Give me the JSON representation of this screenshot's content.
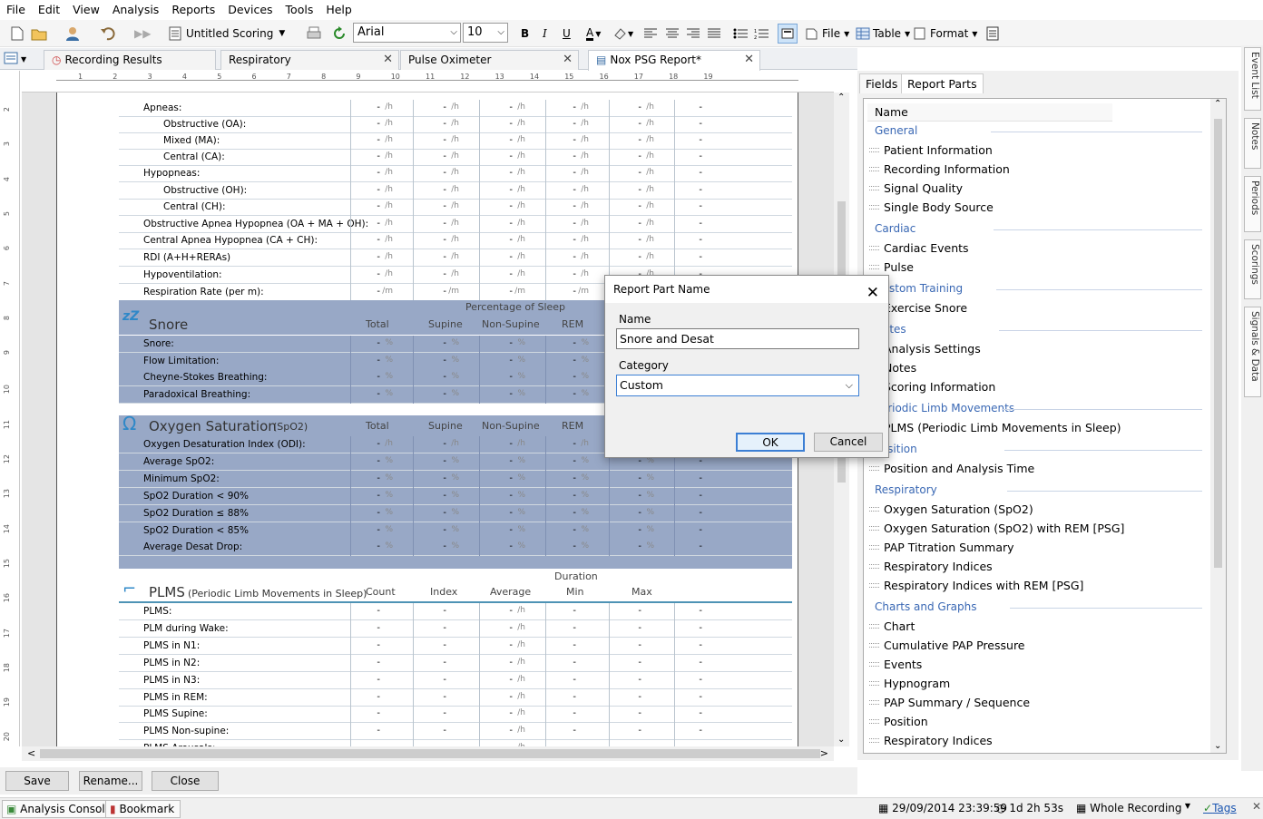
{
  "menu": [
    "File",
    "Edit",
    "View",
    "Analysis",
    "Reports",
    "Devices",
    "Tools",
    "Help"
  ],
  "toolbar": {
    "scoring": "Untitled Scoring",
    "font": "Arial",
    "size": "10",
    "file": "File",
    "table": "Table",
    "format": "Format"
  },
  "doc_tabs": [
    "Recording Results",
    "Respiratory",
    "Pulse Oximeter",
    "Nox PSG Report*"
  ],
  "ruler_marks": [
    "1",
    "2",
    "3",
    "4",
    "5",
    "6",
    "7",
    "8",
    "9",
    "10",
    "11",
    "12",
    "13",
    "14",
    "15",
    "16",
    "17",
    "18",
    "19"
  ],
  "vruler_marks": [
    "2",
    "3",
    "4",
    "5",
    "6",
    "7",
    "8",
    "9",
    "10",
    "11",
    "12",
    "13",
    "14",
    "15",
    "16",
    "17",
    "18",
    "19",
    "20"
  ],
  "resp_rows": [
    {
      "label": "Apneas:",
      "unit": "/h",
      "indent": 0
    },
    {
      "label": "Obstructive (OA):",
      "unit": "/h",
      "indent": 1
    },
    {
      "label": "Mixed (MA):",
      "unit": "/h",
      "indent": 1
    },
    {
      "label": "Central (CA):",
      "unit": "/h",
      "indent": 1
    },
    {
      "label": "Hypopneas:",
      "unit": "/h",
      "indent": 0
    },
    {
      "label": "Obstructive (OH):",
      "unit": "/h",
      "indent": 1
    },
    {
      "label": "Central (CH):",
      "unit": "/h",
      "indent": 1
    },
    {
      "label": "Obstructive Apnea Hypopnea (OA + MA + OH):",
      "unit": "/h",
      "indent": 0
    },
    {
      "label": "Central Apnea Hypopnea (CA + CH):",
      "unit": "/h",
      "indent": 0
    },
    {
      "label": "RDI (A+H+RERAs)",
      "unit": "/h",
      "indent": 0
    },
    {
      "label": "Hypoventilation:",
      "unit": "/h",
      "indent": 0
    },
    {
      "label": "Respiration Rate (per m):",
      "unit": "/m",
      "indent": 0
    }
  ],
  "snore": {
    "title": "Snore",
    "pct_header": "Percentage of Sleep",
    "cols": [
      "Total",
      "Supine",
      "Non-Supine",
      "REM"
    ],
    "rows": [
      "Snore:",
      "Flow Limitation:",
      "Cheyne-Stokes Breathing:",
      "Paradoxical Breathing:"
    ]
  },
  "oxy": {
    "title": "Oxygen Saturation",
    "suffix": "(SpO2)",
    "cols": [
      "Total",
      "Supine",
      "Non-Supine",
      "REM"
    ],
    "rows": [
      {
        "label": "Oxygen Desaturation Index (ODI):",
        "unit": "/h",
        "min": false
      },
      {
        "label": "Average SpO2:",
        "unit": "%",
        "min": false
      },
      {
        "label": "Minimum SpO2:",
        "unit": "%",
        "min": false
      },
      {
        "label": "SpO2 Duration < 90%",
        "unit": "%",
        "min": true
      },
      {
        "label": "SpO2 Duration ≤ 88%",
        "unit": "%",
        "min": true
      },
      {
        "label": "SpO2 Duration < 85%",
        "unit": "%",
        "min": true
      },
      {
        "label": "Average Desat Drop:",
        "unit": "%",
        "min": false
      }
    ]
  },
  "plms": {
    "title": "PLMS",
    "suffix": "(Periodic Limb Movements in Sleep)",
    "duration": "Duration",
    "cols": [
      "Count",
      "Index",
      "Average",
      "Min",
      "Max"
    ],
    "rows": [
      "PLMS:",
      "PLM during Wake:",
      "PLMS in N1:",
      "PLMS in N2:",
      "PLMS in N3:",
      "PLMS in REM:",
      "PLMS Supine:",
      "PLMS Non-supine:",
      "PLMS Arousals:"
    ]
  },
  "right_tabs": [
    "Fields",
    "Report Parts"
  ],
  "list_header": "Name",
  "parts": [
    {
      "cat": "General",
      "items": [
        "Patient Information",
        "Recording Information",
        "Signal Quality",
        "Single Body Source"
      ]
    },
    {
      "cat": "Cardiac",
      "items": [
        "Cardiac Events",
        "Pulse"
      ]
    },
    {
      "cat": "Custom Training",
      "items": [
        "Exercise Snore"
      ]
    },
    {
      "cat": "Notes",
      "items": [
        "Analysis Settings",
        "Notes",
        "Scoring Information"
      ]
    },
    {
      "cat": "Periodic Limb Movements",
      "items": [
        "PLMS (Periodic Limb Movements in Sleep)"
      ]
    },
    {
      "cat": "Position",
      "items": [
        "Position and Analysis Time"
      ]
    },
    {
      "cat": "Respiratory",
      "items": [
        "Oxygen Saturation (SpO2)",
        "Oxygen Saturation (SpO2) with REM [PSG]",
        "PAP Titration Summary",
        "Respiratory Indices",
        "Respiratory Indices with REM [PSG]"
      ]
    },
    {
      "cat": "Charts and Graphs",
      "items": [
        "Chart",
        "Cumulative PAP Pressure",
        "Events",
        "Hypnogram",
        "PAP Summary / Sequence",
        "Position",
        "Respiratory Indices"
      ]
    }
  ],
  "side_tabs": [
    "Event List",
    "Notes",
    "Periods",
    "Scorings",
    "Signals & Data"
  ],
  "bottom_buttons": [
    "Save",
    "Rename...",
    "Close"
  ],
  "status": {
    "console": "Analysis Console",
    "bookmark": "Bookmark",
    "datetime": "29/09/2014 23:39:59",
    "duration": "1d 2h 53s",
    "range": "Whole Recording",
    "tags": "Tags"
  },
  "dialog": {
    "title": "Report Part Name",
    "name_label": "Name",
    "name_value": "Snore and Desat",
    "category_label": "Category",
    "category_value": "Custom",
    "ok": "OK",
    "cancel": "Cancel"
  },
  "dash": "-"
}
